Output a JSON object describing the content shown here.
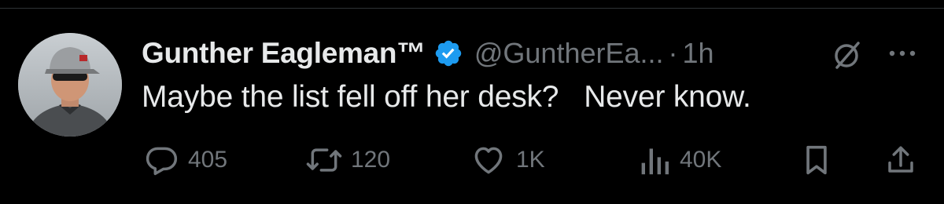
{
  "tweet": {
    "author": {
      "display_name": "Gunther Eagleman™",
      "handle": "@GuntherEa...",
      "verified": true,
      "avatar_icon": "profile-photo"
    },
    "separator": "·",
    "time": "1h",
    "text": "Maybe the list fell off her desk?   Never know.",
    "header_icons": [
      "grok-icon",
      "more-icon"
    ]
  },
  "actions": {
    "reply": {
      "icon": "reply-icon",
      "count": "405"
    },
    "retweet": {
      "icon": "retweet-icon",
      "count": "120"
    },
    "like": {
      "icon": "heart-icon",
      "count": "1K"
    },
    "views": {
      "icon": "views-icon",
      "count": "40K"
    },
    "bookmark": {
      "icon": "bookmark-icon"
    },
    "share": {
      "icon": "share-icon"
    }
  },
  "colors": {
    "background": "#000000",
    "primary_text": "#e7e9ea",
    "secondary_text": "#71767b",
    "verified_blue": "#1d9bf0"
  }
}
